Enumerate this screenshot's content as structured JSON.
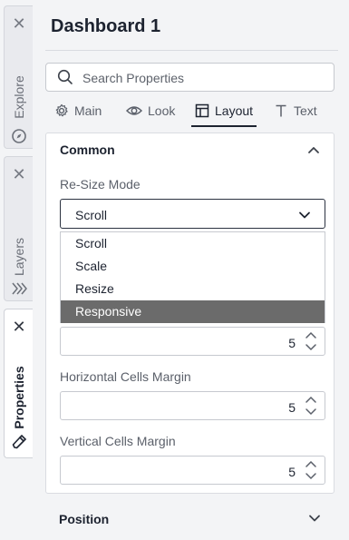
{
  "rail": {
    "tabs": [
      {
        "label": "Explore",
        "icon": "compass-icon",
        "active": false
      },
      {
        "label": "Layers",
        "icon": "layers-icon",
        "active": false
      },
      {
        "label": "Properties",
        "icon": "brush-icon",
        "active": true
      }
    ]
  },
  "panel": {
    "title": "Dashboard 1",
    "search_placeholder": "Search Properties",
    "tabs": [
      {
        "label": "Main",
        "icon": "gear-icon"
      },
      {
        "label": "Look",
        "icon": "eye-icon"
      },
      {
        "label": "Layout",
        "icon": "layout-icon",
        "active": true
      },
      {
        "label": "Text",
        "icon": "text-icon"
      }
    ]
  },
  "common": {
    "title": "Common",
    "resize_label": "Re-Size Mode",
    "resize_value": "Scroll",
    "options": [
      "Scroll",
      "Scale",
      "Resize",
      "Responsive"
    ],
    "highlighted_option": "Responsive",
    "field1_value": "5",
    "horizontal_label": "Horizontal Cells Margin",
    "horizontal_value": "5",
    "vertical_label": "Vertical Cells Margin",
    "vertical_value": "5"
  },
  "position": {
    "title": "Position"
  },
  "colors": {
    "accent": "#1d2330",
    "highlight": "#6b6b6b"
  }
}
